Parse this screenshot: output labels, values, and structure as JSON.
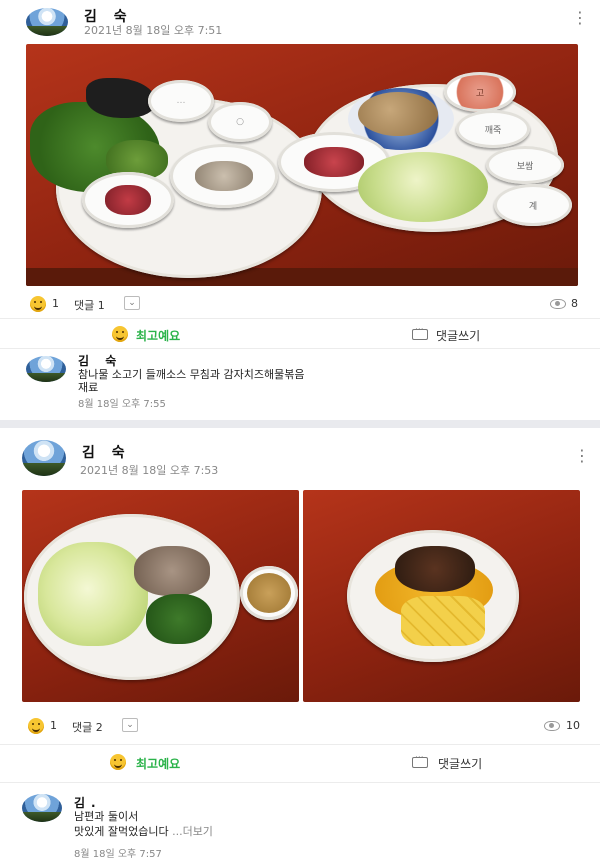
{
  "colors": {
    "accent_green": "#2bb34a",
    "muted": "#888888",
    "background": "#e9eaee"
  },
  "posts": [
    {
      "author": "김 숙",
      "time": "2021년 8월 18일 오후 7:51",
      "menu_icon": "more-vertical-icon",
      "photo_labels": {
        "bowl_red": "고",
        "bowl_plain1": "깨죽",
        "bowl_plain2": "보쌈",
        "bowl_plain3": "계"
      },
      "reactions": {
        "like_count": "1",
        "comment_label": "댓글 1",
        "view_count": "8"
      },
      "actions": {
        "best": "최고예요",
        "write": "댓글쓰기"
      },
      "comment": {
        "author": "김 숙",
        "text_line1": "참나물 소고기 들깨소스 무침과 감자치즈해물볶음",
        "text_line2": "재료",
        "time": "8월 18일 오후 7:55"
      }
    },
    {
      "author": "김 숙",
      "time": "2021년 8월 18일 오후 7:53",
      "menu_icon": "more-vertical-icon",
      "reactions": {
        "like_count": "1",
        "comment_label": "댓글 2",
        "view_count": "10"
      },
      "actions": {
        "best": "최고예요",
        "write": "댓글쓰기"
      },
      "comment": {
        "author": "김.",
        "text_line1": "남편과 둘이서",
        "text_line2": "맛있게 잘먹었습니다",
        "more": "...더보기",
        "time": "8월 18일 오후 7:57"
      }
    }
  ]
}
